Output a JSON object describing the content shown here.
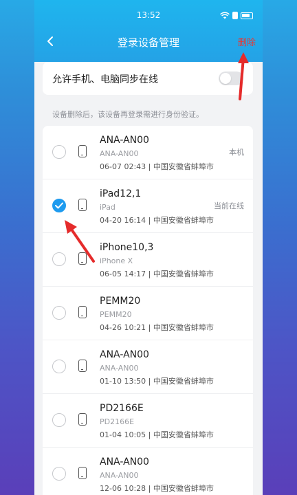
{
  "status_bar": {
    "time": "13:52"
  },
  "header": {
    "title": "登录设备管理",
    "delete_label": "删除"
  },
  "sync": {
    "label": "允许手机、电脑同步在线",
    "enabled": false
  },
  "hint": "设备删除后，该设备再登录需进行身份验证。",
  "devices": [
    {
      "name": "ANA-AN00",
      "model": "ANA-AN00",
      "meta": "06-07 02:43 | 中国安徽省蚌埠市",
      "tag": "本机",
      "checked": false
    },
    {
      "name": "iPad12,1",
      "model": "iPad",
      "meta": "04-20 16:14 | 中国安徽省蚌埠市",
      "tag": "当前在线",
      "checked": true
    },
    {
      "name": "iPhone10,3",
      "model": "iPhone X",
      "meta": "06-05 14:17 | 中国安徽省蚌埠市",
      "tag": "",
      "checked": false
    },
    {
      "name": "PEMM20",
      "model": "PEMM20",
      "meta": "04-26 10:21 | 中国安徽省蚌埠市",
      "tag": "",
      "checked": false
    },
    {
      "name": "ANA-AN00",
      "model": "ANA-AN00",
      "meta": "01-10 13:50 | 中国安徽省蚌埠市",
      "tag": "",
      "checked": false
    },
    {
      "name": "PD2166E",
      "model": "PD2166E",
      "meta": "01-04 10:05 | 中国安徽省蚌埠市",
      "tag": "",
      "checked": false
    },
    {
      "name": "ANA-AN00",
      "model": "ANA-AN00",
      "meta": "12-06 10:28 | 中国安徽省蚌埠市",
      "tag": "",
      "checked": false
    }
  ],
  "colors": {
    "accent": "#1e9bef",
    "delete": "#e53935",
    "annotation_arrow": "#e52b2b"
  }
}
